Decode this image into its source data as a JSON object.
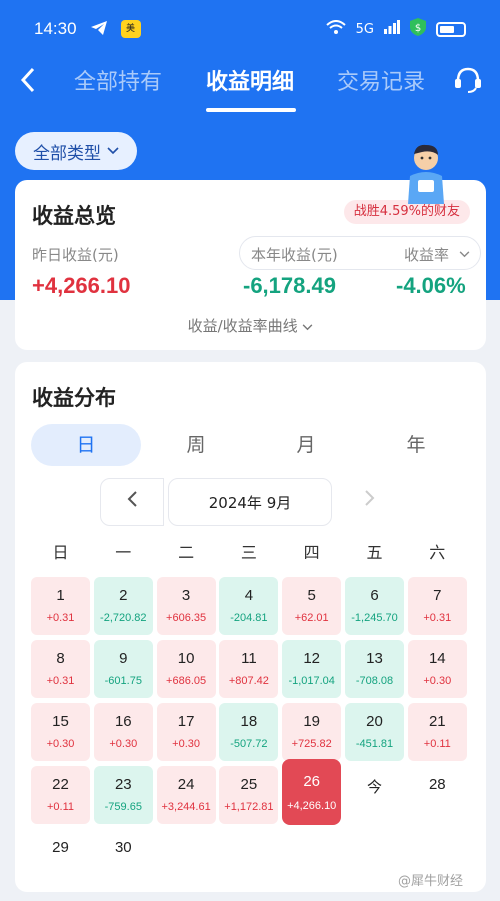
{
  "status": {
    "time": "14:30",
    "network": "5G"
  },
  "nav": {
    "tabs": [
      "全部持有",
      "收益明细",
      "交易记录"
    ],
    "active_tab": 1
  },
  "filter": {
    "label": "全部类型"
  },
  "summary": {
    "title": "收益总览",
    "badge": "战胜4.59%的财友",
    "yesterday_label": "昨日收益(元)",
    "yesterday_value": "+4,266.10",
    "year_label": "本年收益(元)",
    "year_value": "-6,178.49",
    "rate_label": "收益率",
    "rate_value": "-4.06%",
    "curve_link": "收益/收益率曲线"
  },
  "distribution": {
    "title": "收益分布",
    "periods": [
      "日",
      "周",
      "月",
      "年"
    ],
    "active_period": 0,
    "month": "2024年 9月",
    "weekdays": [
      "日",
      "一",
      "二",
      "三",
      "四",
      "五",
      "六"
    ],
    "days": [
      {
        "d": "1",
        "v": "+0.31",
        "t": "pos"
      },
      {
        "d": "2",
        "v": "-2,720.82",
        "t": "neg"
      },
      {
        "d": "3",
        "v": "+606.35",
        "t": "pos"
      },
      {
        "d": "4",
        "v": "-204.81",
        "t": "neg"
      },
      {
        "d": "5",
        "v": "+62.01",
        "t": "pos"
      },
      {
        "d": "6",
        "v": "-1,245.70",
        "t": "neg"
      },
      {
        "d": "7",
        "v": "+0.31",
        "t": "pos"
      },
      {
        "d": "8",
        "v": "+0.31",
        "t": "pos"
      },
      {
        "d": "9",
        "v": "-601.75",
        "t": "neg"
      },
      {
        "d": "10",
        "v": "+686.05",
        "t": "pos"
      },
      {
        "d": "11",
        "v": "+807.42",
        "t": "pos"
      },
      {
        "d": "12",
        "v": "-1,017.04",
        "t": "neg"
      },
      {
        "d": "13",
        "v": "-708.08",
        "t": "neg"
      },
      {
        "d": "14",
        "v": "+0.30",
        "t": "pos"
      },
      {
        "d": "15",
        "v": "+0.30",
        "t": "pos"
      },
      {
        "d": "16",
        "v": "+0.30",
        "t": "pos"
      },
      {
        "d": "17",
        "v": "+0.30",
        "t": "pos"
      },
      {
        "d": "18",
        "v": "-507.72",
        "t": "neg"
      },
      {
        "d": "19",
        "v": "+725.82",
        "t": "pos"
      },
      {
        "d": "20",
        "v": "-451.81",
        "t": "neg"
      },
      {
        "d": "21",
        "v": "+0.11",
        "t": "pos"
      },
      {
        "d": "22",
        "v": "+0.11",
        "t": "pos"
      },
      {
        "d": "23",
        "v": "-759.65",
        "t": "neg"
      },
      {
        "d": "24",
        "v": "+3,244.61",
        "t": "pos"
      },
      {
        "d": "25",
        "v": "+1,172.81",
        "t": "pos"
      },
      {
        "d": "26",
        "v": "+4,266.10",
        "t": "today"
      },
      {
        "d": "今",
        "v": "",
        "t": "plain"
      },
      {
        "d": "28",
        "v": "",
        "t": "plain"
      },
      {
        "d": "29",
        "v": "",
        "t": "plain"
      },
      {
        "d": "30",
        "v": "",
        "t": "plain"
      }
    ]
  },
  "watermark": "@犀牛财经",
  "colors": {
    "brand_blue": "#1f73f2",
    "gain_red": "#e0323f",
    "loss_green": "#14a37f"
  }
}
